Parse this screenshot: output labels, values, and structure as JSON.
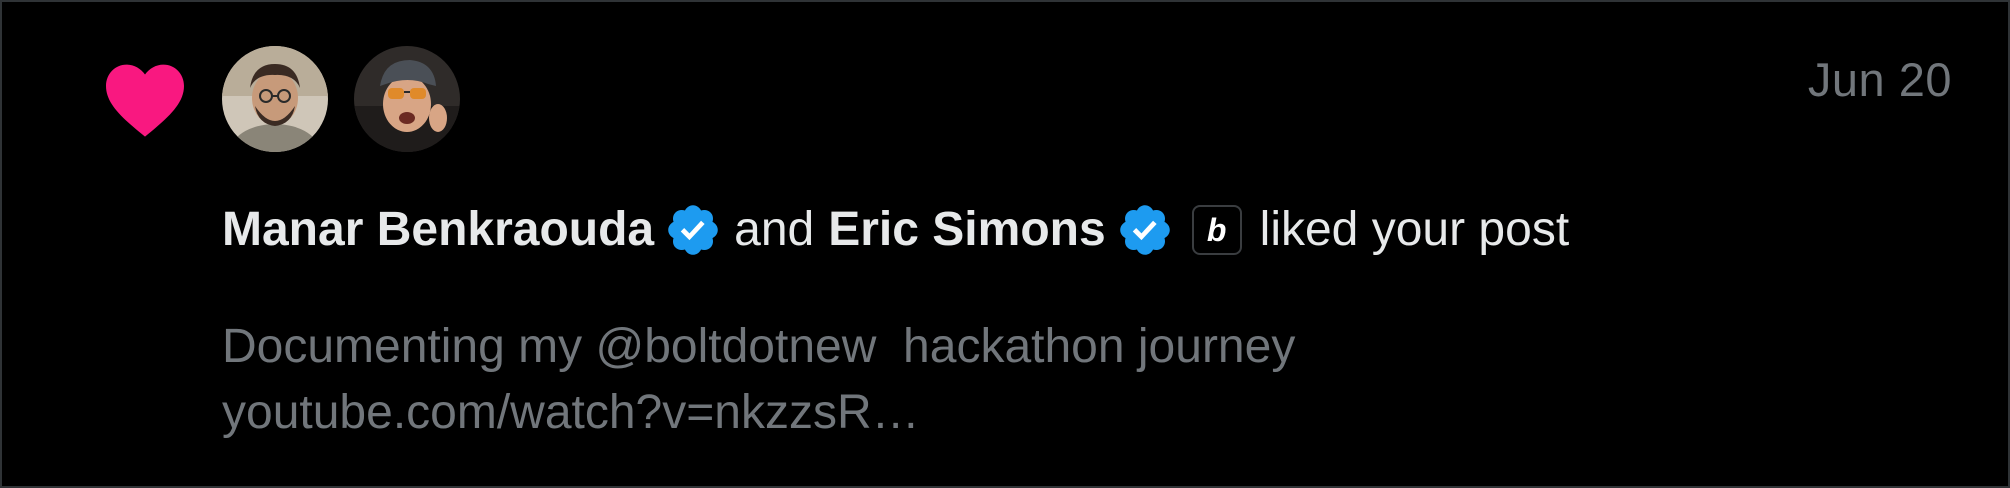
{
  "notification": {
    "type": "like",
    "date": "Jun 20",
    "users": [
      {
        "name": "Manar Benkraouda",
        "verified": true
      },
      {
        "name": "Eric Simons",
        "verified": true,
        "affiliate_badge": "b"
      }
    ],
    "connector": "and",
    "action_text": "liked your post",
    "post_preview": {
      "line1": "Documenting my @boltdotnew  hackathon journey",
      "line2": "youtube.com/watch?v=nkzzsR…"
    }
  },
  "colors": {
    "heart": "#f91880",
    "verified": "#1d9bf0",
    "background": "#000000",
    "primary_text": "#e7e9ea",
    "secondary_text": "#71767b"
  },
  "icons": {
    "heart": "heart-icon",
    "verified": "verified-badge-icon"
  }
}
